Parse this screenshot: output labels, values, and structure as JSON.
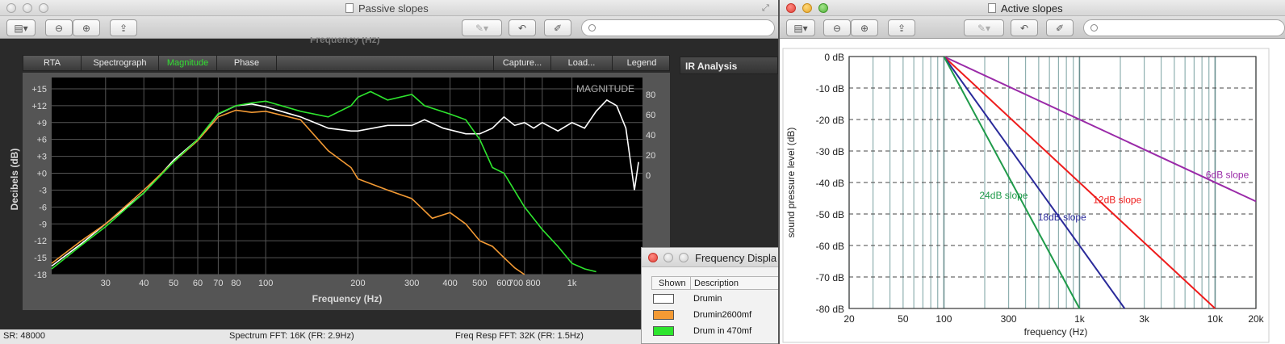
{
  "left_window": {
    "title": "Passive slopes",
    "scrolled_label": "Frequency (Hz)",
    "toolbar_icons": [
      "sidebar-icon",
      "zoom-out-icon",
      "zoom-in-icon",
      "share-icon",
      "markup-icon",
      "rotate-icon",
      "edit-icon"
    ],
    "tabs": {
      "rta": "RTA",
      "spectrograph": "Spectrograph",
      "magnitude": "Magnitude",
      "phase": "Phase",
      "capture": "Capture...",
      "load": "Load...",
      "legend": "Legend"
    },
    "ir_analysis": "IR Analysis",
    "status": {
      "sr": "SR: 48000",
      "spectrum": "Spectrum FFT: 16K (FR: 2.9Hz)",
      "freq_resp": "Freq Resp FFT: 32K (FR: 1.5Hz)"
    }
  },
  "freq_display": {
    "title": "Frequency Displa",
    "col_shown": "Shown",
    "col_description": "Description",
    "rows": [
      {
        "label": "Drumin",
        "color": "#ffffff"
      },
      {
        "label": "Drumin2600mf",
        "color": "#f39a34"
      },
      {
        "label": "Drum in 470mf",
        "color": "#2ee52e"
      }
    ]
  },
  "right_window": {
    "title": "Active slopes"
  },
  "chart_data": [
    {
      "type": "line",
      "panel_label": "MAGNITUDE",
      "xlabel": "Frequency (Hz)",
      "ylabel": "Decibels (dB)",
      "x_scale": "log",
      "xlim": [
        20,
        1700
      ],
      "ylim": [
        -18,
        17
      ],
      "x_ticks": [
        30,
        40,
        50,
        60,
        70,
        80,
        100,
        200,
        300,
        400,
        500,
        600,
        700,
        800,
        1000
      ],
      "x_tick_labels": [
        "30",
        "40",
        "50",
        "60",
        "70",
        "80",
        "100",
        "200",
        "300",
        "400",
        "500",
        "600",
        "700 800",
        "",
        "1k"
      ],
      "y_ticks": [
        15,
        12,
        9,
        6,
        3,
        0,
        -3,
        -6,
        -9,
        -12,
        -15,
        -18
      ],
      "y_tick_labels": [
        "+15",
        "+12",
        "+9",
        "+6",
        "+3",
        "+0",
        "-3",
        "-6",
        "-9",
        "-12",
        "-15",
        "-18"
      ],
      "y2_tick_labels": [
        "80",
        "60",
        "40",
        "20",
        "0"
      ],
      "grid": true,
      "series": [
        {
          "name": "Drumin",
          "color": "#ffffff",
          "x": [
            20,
            25,
            30,
            40,
            50,
            60,
            70,
            80,
            90,
            100,
            130,
            160,
            190,
            200,
            250,
            300,
            330,
            380,
            450,
            500,
            550,
            600,
            650,
            700,
            750,
            800,
            900,
            1000,
            1100,
            1200,
            1300,
            1400,
            1500,
            1600,
            1650
          ],
          "y": [
            -16.5,
            -12.5,
            -9,
            -3.5,
            2.3,
            6,
            10.5,
            12,
            12.3,
            11.8,
            10,
            8,
            7.5,
            7.5,
            8.5,
            8.5,
            9.5,
            8,
            7,
            7,
            8,
            10,
            8.5,
            9,
            8,
            9,
            7.5,
            9,
            8,
            11,
            13,
            12,
            8,
            -3,
            2
          ]
        },
        {
          "name": "Drumin2600mf",
          "color": "#f39a34",
          "x": [
            20,
            25,
            30,
            40,
            50,
            60,
            70,
            80,
            90,
            100,
            130,
            160,
            190,
            200,
            250,
            300,
            350,
            400,
            450,
            500,
            550,
            600,
            650,
            700
          ],
          "y": [
            -16,
            -12,
            -9,
            -3,
            2,
            5.8,
            10,
            11.2,
            10.8,
            11,
            9.5,
            4,
            1,
            -1,
            -3,
            -4.5,
            -8,
            -7,
            -9,
            -12,
            -13,
            -15,
            -16.8,
            -18
          ]
        },
        {
          "name": "Drum in 470mf",
          "color": "#2ee52e",
          "x": [
            20,
            25,
            30,
            40,
            50,
            60,
            70,
            80,
            90,
            100,
            130,
            160,
            190,
            200,
            220,
            250,
            300,
            330,
            400,
            450,
            500,
            550,
            600,
            700,
            800,
            900,
            1000,
            1100,
            1200
          ],
          "y": [
            -17,
            -12.8,
            -9.5,
            -3.5,
            2,
            6,
            10.6,
            12,
            12.5,
            12.8,
            11,
            10,
            12,
            13.5,
            14.5,
            13,
            14,
            12,
            10.5,
            9.5,
            6,
            1,
            0,
            -6,
            -10,
            -13,
            -16,
            -17,
            -17.5
          ]
        }
      ]
    },
    {
      "type": "line",
      "xlabel": "frequency (Hz)",
      "ylabel": "sound pressure level (dB)",
      "x_scale": "log",
      "xlim": [
        20,
        20000
      ],
      "ylim": [
        -80,
        0
      ],
      "x_ticks": [
        20,
        50,
        100,
        300,
        1000,
        3000,
        10000,
        20000
      ],
      "x_tick_labels": [
        "20",
        "50",
        "100",
        "300",
        "1k",
        "3k",
        "10k",
        "20k"
      ],
      "y_ticks": [
        0,
        -10,
        -20,
        -30,
        -40,
        -50,
        -60,
        -70,
        -80
      ],
      "y_tick_labels": [
        "0 dB",
        "-10 dB",
        "-20 dB",
        "-30 dB",
        "-40 dB",
        "-50 dB",
        "-60 dB",
        "-70 dB",
        "-80 dB"
      ],
      "grid": true,
      "series": [
        {
          "name": "6dB slope",
          "color": "#9a2aa8",
          "x": [
            100,
            20000
          ],
          "y": [
            0,
            -46
          ]
        },
        {
          "name": "12dB slope",
          "color": "#ee1c1c",
          "x": [
            100,
            10000
          ],
          "y": [
            0,
            -80
          ]
        },
        {
          "name": "18dB slope",
          "color": "#2a2a9a",
          "x": [
            100,
            2150
          ],
          "y": [
            0,
            -80
          ]
        },
        {
          "name": "24dB slope",
          "color": "#1f9a4a",
          "x": [
            100,
            1000
          ],
          "y": [
            0,
            -80
          ]
        }
      ],
      "annotations": [
        "6dB slope",
        "12dB slope",
        "18dB slope",
        "24dB slope"
      ]
    }
  ]
}
